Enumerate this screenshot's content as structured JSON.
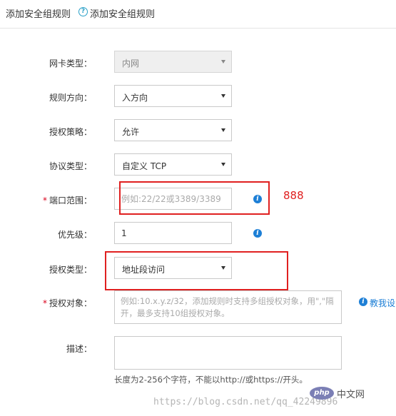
{
  "header": {
    "title": "添加安全组规则",
    "help_glyph": "?",
    "help_link": "添加安全组规则"
  },
  "form": {
    "nic_type": {
      "label": "网卡类型：",
      "value": "内网",
      "disabled": true
    },
    "direction": {
      "label": "规则方向：",
      "value": "入方向"
    },
    "policy": {
      "label": "授权策略：",
      "value": "允许"
    },
    "protocol": {
      "label": "协议类型：",
      "value": "自定义 TCP"
    },
    "port_range": {
      "required_mark": "*",
      "label": "端口范围：",
      "value": "",
      "placeholder": "例如:22/22或3389/3389"
    },
    "priority": {
      "label": "优先级：",
      "value": "1"
    },
    "auth_type": {
      "label": "授权类型：",
      "value": "地址段访问"
    },
    "auth_object": {
      "required_mark": "*",
      "label": "授权对象：",
      "value": "",
      "placeholder": "例如:10.x.y.z/32，添加规则时支持多组授权对象，用\",\"隔开，最多支持10组授权对象。",
      "help_link": "教我设"
    },
    "description": {
      "label": "描述：",
      "value": "",
      "hint": "长度为2-256个字符，不能以http://或https://开头。"
    }
  },
  "info_glyph": "i",
  "annotation": {
    "text": "888",
    "color": "#e02020"
  },
  "watermark": {
    "url": "https://blog.csdn.net/qq_42249896",
    "badge": "php",
    "site": "中文网"
  },
  "colors": {
    "accent": "#1d7fd6",
    "annotation_red": "#e02020",
    "border": "#c9c9c9"
  }
}
